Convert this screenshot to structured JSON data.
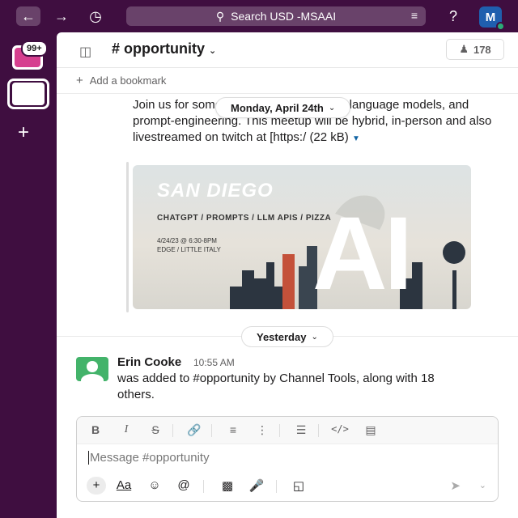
{
  "topbar": {
    "search_text": "Search USD -MSAAI",
    "user_initial": "M"
  },
  "sidebar": {
    "badge": "99+",
    "add_label": "+"
  },
  "channel": {
    "name": "# opportunity",
    "member_count": "178",
    "bookmark_label": "Add a bookmark"
  },
  "message1": {
    "text": "Join us for some discussion about large language models, and prompt-engineering. This meetup will be hybrid, in-person and also livestreamed on twitch at [https:/",
    "size": "(22 kB)"
  },
  "date_pill": "Monday, April 24th",
  "attachment": {
    "title": "SAN DIEGO",
    "subtitle": "CHATGPT / PROMPTS / LLM APIS / PIZZA",
    "date_line1": "4/24/23 @ 6:30-8PM",
    "date_line2": "EDGE / LITTLE ITALY",
    "big": "AI"
  },
  "yesterday_pill": "Yesterday",
  "message2": {
    "author": "Erin Cooke",
    "time": "10:55 AM",
    "text": "was added to #opportunity by Channel Tools, along with 18 others."
  },
  "composer": {
    "placeholder": "Message #opportunity",
    "aa": "Aa"
  },
  "colors": {
    "sidebar_bg": "#3f0e40",
    "link": "#1264a3",
    "avatar_green": "#43b36a"
  }
}
